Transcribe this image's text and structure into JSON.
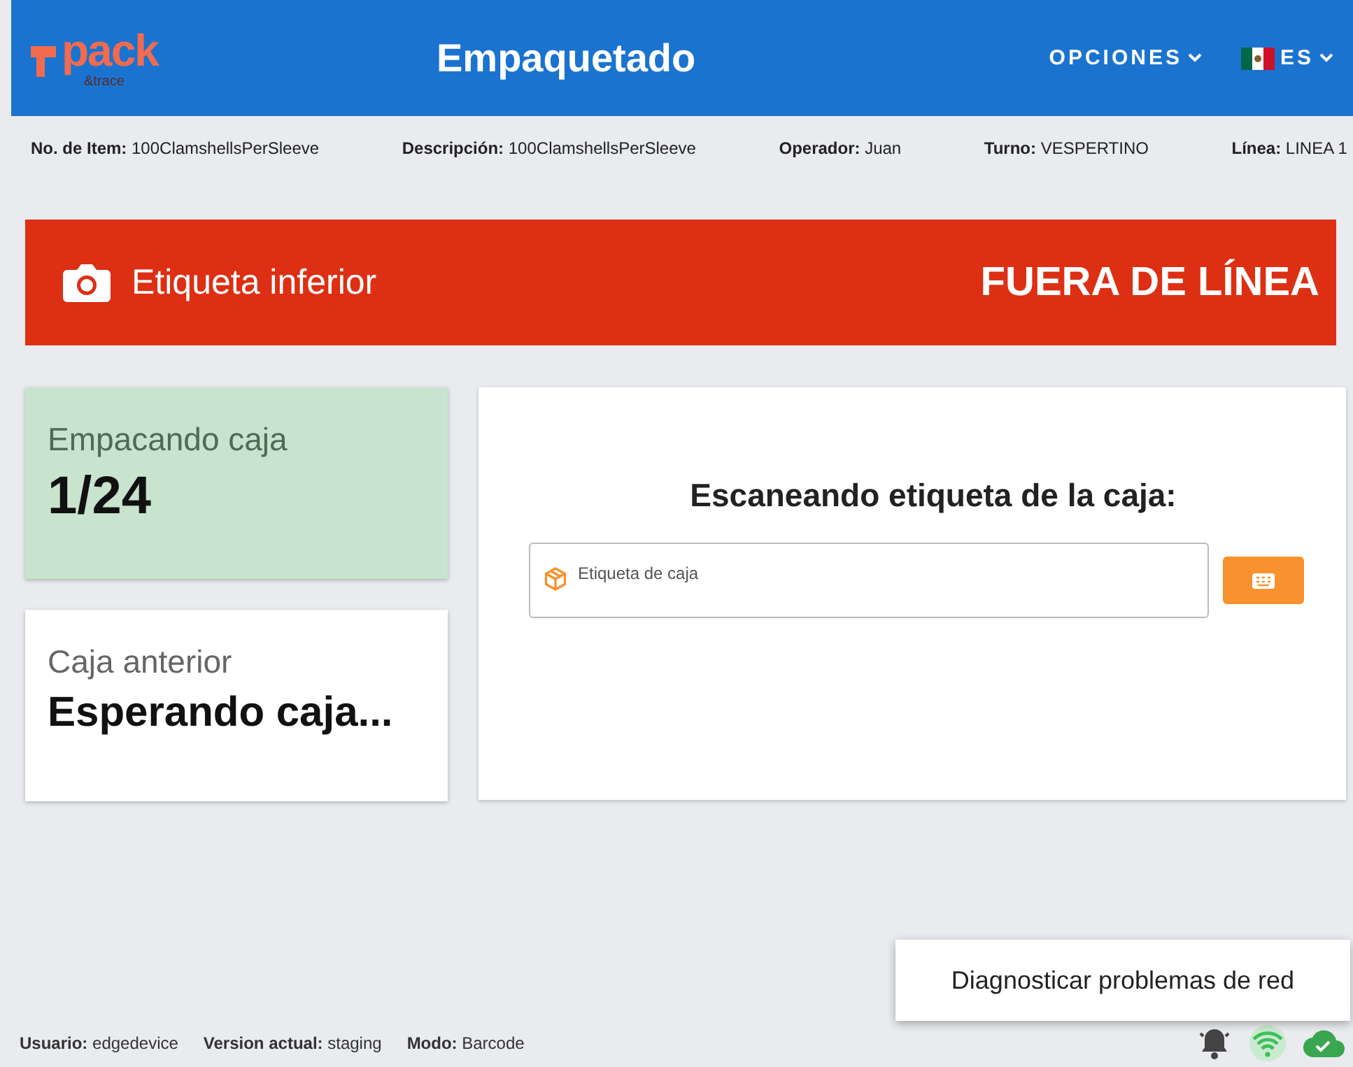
{
  "header": {
    "logo": {
      "word": "pack",
      "tagline": "&trace"
    },
    "title": "Empaquetado",
    "menu": "OPCIONES",
    "language": "ES"
  },
  "info": [
    "**No. de Item:** 100ClamshellsPerSleeve",
    "**Descripción:** 100ClamshellsPerSleeve",
    "**Operador:** Juan",
    "**Turno:** VESPERTINO",
    "**Línea:** LINEA 1"
  ],
  "banner": {
    "label": "Etiqueta inferior",
    "status": "FUERA DE LÍNEA"
  },
  "cards": [
    {
      "kind": "current",
      "label": "Empacando caja",
      "value": "1/24"
    },
    {
      "kind": "previous",
      "label": "Caja anterior",
      "value": "Esperando caja..."
    }
  ],
  "scan": {
    "title": "Escaneando etiqueta de la caja:",
    "placeholder": "Etiqueta de caja"
  },
  "tooltip": "Diagnosticar problemas de red",
  "footer": [
    "**Usuario:** edgedevice",
    "**Version actual:** staging",
    "**Modo:** Barcode"
  ]
}
